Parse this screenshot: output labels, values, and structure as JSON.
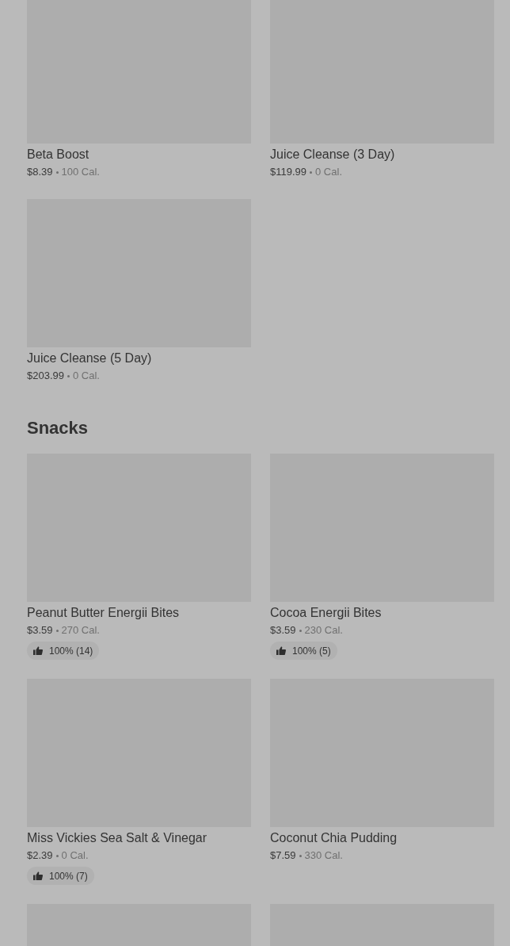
{
  "sections": [
    {
      "items": [
        {
          "kind": "product",
          "name": "Beta Boost",
          "price": "$8.39",
          "calories": "100 Cal."
        },
        {
          "kind": "product",
          "name": "Juice Cleanse (3 Day)",
          "price": "$119.99",
          "calories": "0 Cal."
        },
        {
          "kind": "product",
          "name": "Juice Cleanse (5 Day)",
          "price": "$203.99",
          "calories": "0 Cal."
        }
      ]
    },
    {
      "title": "Snacks",
      "items": [
        {
          "kind": "product",
          "name": "Peanut Butter Energii Bites",
          "price": "$3.59",
          "calories": "270 Cal.",
          "rating": "100% (14)"
        },
        {
          "kind": "product",
          "name": "Cocoa Energii Bites",
          "price": "$3.59",
          "calories": "230 Cal.",
          "rating": "100% (5)"
        },
        {
          "kind": "product",
          "name": "Miss Vickies Sea Salt & Vinegar",
          "price": "$2.39",
          "calories": "0 Cal.",
          "rating": "100% (7)"
        },
        {
          "kind": "product",
          "name": "Coconut Chia Pudding",
          "price": "$7.59",
          "calories": "330 Cal."
        },
        {
          "kind": "image_only"
        },
        {
          "kind": "image_only"
        }
      ]
    }
  ]
}
